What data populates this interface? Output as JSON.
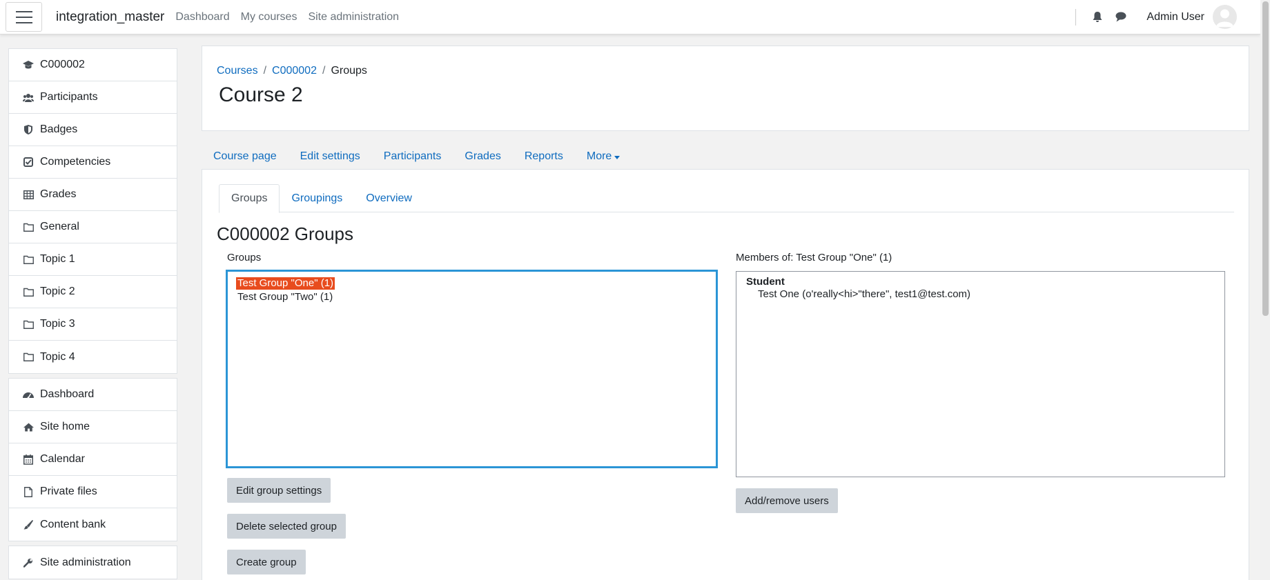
{
  "navbar": {
    "brand": "integration_master",
    "links": [
      "Dashboard",
      "My courses",
      "Site administration"
    ],
    "user_name": "Admin User",
    "icons": [
      "hamburger-icon",
      "bell-icon",
      "chat-icon",
      "avatar-icon"
    ]
  },
  "sidebar": {
    "course_items": [
      {
        "label": "C000002",
        "icon": "graduation-cap-icon"
      },
      {
        "label": "Participants",
        "icon": "users-icon"
      },
      {
        "label": "Badges",
        "icon": "shield-icon"
      },
      {
        "label": "Competencies",
        "icon": "check-square-icon"
      },
      {
        "label": "Grades",
        "icon": "table-icon"
      },
      {
        "label": "General",
        "icon": "folder-icon"
      },
      {
        "label": "Topic 1",
        "icon": "folder-icon"
      },
      {
        "label": "Topic 2",
        "icon": "folder-icon"
      },
      {
        "label": "Topic 3",
        "icon": "folder-icon"
      },
      {
        "label": "Topic 4",
        "icon": "folder-icon"
      }
    ],
    "site_items": [
      {
        "label": "Dashboard",
        "icon": "tachometer-icon"
      },
      {
        "label": "Site home",
        "icon": "home-icon"
      },
      {
        "label": "Calendar",
        "icon": "calendar-icon"
      },
      {
        "label": "Private files",
        "icon": "file-icon"
      },
      {
        "label": "Content bank",
        "icon": "paintbrush-icon"
      }
    ],
    "admin_items": [
      {
        "label": "Site administration",
        "icon": "wrench-icon"
      }
    ]
  },
  "header": {
    "breadcrumb": [
      "Courses",
      "C000002",
      "Groups"
    ],
    "title": "Course 2"
  },
  "secondary_nav": [
    "Course page",
    "Edit settings",
    "Participants",
    "Grades",
    "Reports",
    "More"
  ],
  "tabs": [
    "Groups",
    "Groupings",
    "Overview"
  ],
  "main": {
    "section_title": "C000002 Groups",
    "groups_label": "Groups",
    "groups": [
      {
        "label": "Test Group \"One\" (1)",
        "selected": true
      },
      {
        "label": "Test Group \"Two\" (1)",
        "selected": false
      }
    ],
    "members_label": "Members of: Test Group \"One\" (1)",
    "members_role": "Student",
    "members_user": "Test One (o'really<hi>\"there\", test1@test.com)",
    "buttons": {
      "edit": "Edit group settings",
      "delete": "Delete selected group",
      "create": "Create group",
      "add_remove": "Add/remove users"
    }
  },
  "colors": {
    "link": "#0f6cbf",
    "selected_option": "#e84c1e",
    "focus_border": "#2b95d6",
    "button": "#ced4da"
  }
}
